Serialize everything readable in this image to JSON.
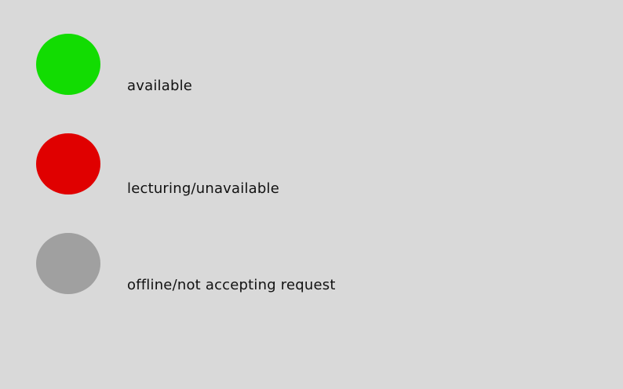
{
  "legend": {
    "items": [
      {
        "label": "available",
        "color": "#12dc02",
        "icon": "status-dot-available"
      },
      {
        "label": "lecturing/unavailable",
        "color": "#e00000",
        "icon": "status-dot-unavailable"
      },
      {
        "label": "offline/not accepting request",
        "color": "#a0a0a0",
        "icon": "status-dot-offline"
      }
    ]
  }
}
